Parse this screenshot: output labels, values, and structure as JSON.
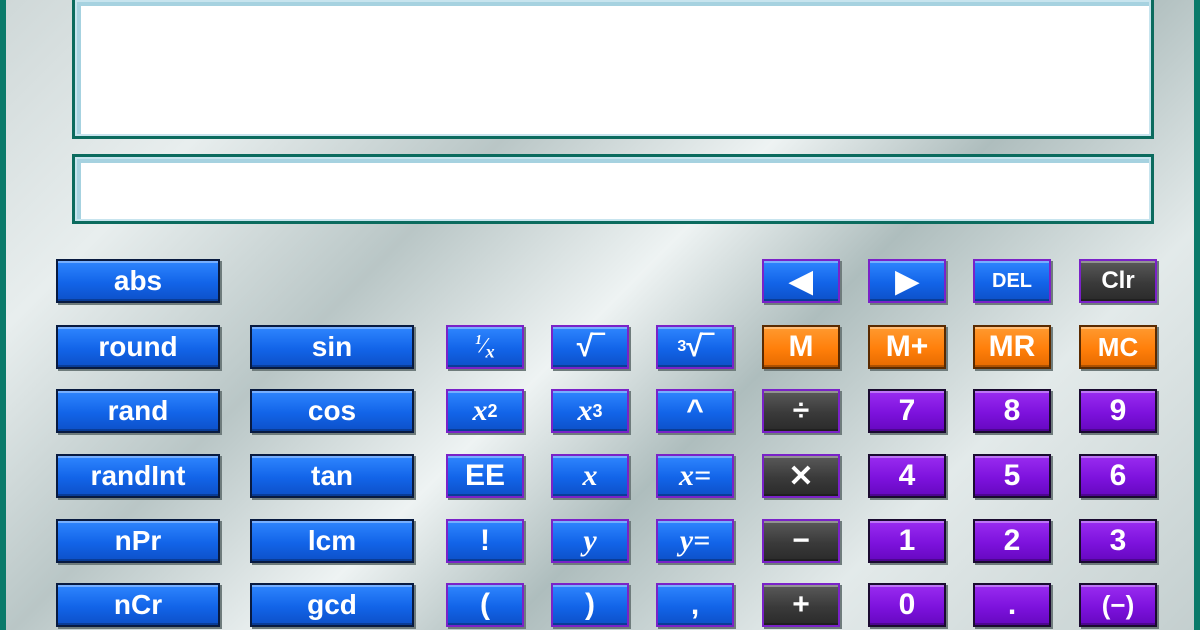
{
  "display": {
    "expression": "",
    "result": ""
  },
  "keys": {
    "abs": "abs",
    "round": "round",
    "rand": "rand",
    "randInt": "randInt",
    "nPr": "nPr",
    "nCr": "nCr",
    "sin": "sin",
    "cos": "cos",
    "tan": "tan",
    "lcm": "lcm",
    "gcd": "gcd",
    "reciprocal_num": "1",
    "reciprocal_den": "x",
    "sqrt": "√‾",
    "cbrt_index": "3",
    "cbrt": "√‾",
    "x_squared_base": "x",
    "x_squared_exp": "2",
    "x_cubed_base": "x",
    "x_cubed_exp": "3",
    "power": "^",
    "ee": "EE",
    "var_x": "x",
    "x_equals": "x=",
    "factorial": "!",
    "var_y": "y",
    "y_equals": "y=",
    "lparen": "(",
    "rparen": ")",
    "comma": ",",
    "left_arrow": "◀",
    "right_arrow": "▶",
    "del": "DEL",
    "clr": "Clr",
    "m": "M",
    "m_plus": "M+",
    "mr": "MR",
    "mc": "MC",
    "divide": "÷",
    "multiply": "✕",
    "minus": "−",
    "plus": "+",
    "d7": "7",
    "d8": "8",
    "d9": "9",
    "d4": "4",
    "d5": "5",
    "d6": "6",
    "d1": "1",
    "d2": "2",
    "d3": "3",
    "d0": "0",
    "decimal": ".",
    "negate": "(−)"
  },
  "colors": {
    "function_key": "#1264e8",
    "memory_key": "#ff7f0a",
    "operator_key": "#3a3a3a",
    "digit_key": "#7d12dd",
    "display_border": "#0b6b5e"
  }
}
